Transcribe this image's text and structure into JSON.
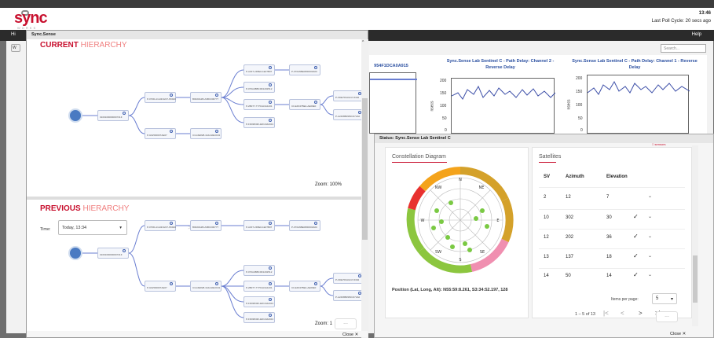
{
  "header": {
    "logo_text": "sync",
    "logo_sub": "WORKS",
    "time": "13:46",
    "poll": "Last Poll Cycle: 20 secs ago"
  },
  "nav": {
    "left_fragment": "Hi",
    "help": "Help",
    "search_placeholder": "Search..."
  },
  "background": {
    "button_fragment": "W",
    "partial_id": "954F1DCA0A915",
    "chart2_title": "Sync.Sense Lab Sentinel C - Path Delay: Channel 2 - Reverse Delay",
    "chart3_title": "Sync.Sense Lab Sentinel C - Path Delay: Channel 1 - Reverse Delay",
    "y_unit": "nsecs",
    "chart2_ticks": [
      "200",
      "150",
      "100",
      "50",
      "0"
    ],
    "chart3_ticks": [
      "200",
      "150",
      "100",
      "50",
      "0"
    ]
  },
  "left_window": {
    "title": "Sync.Sense",
    "current_title_a": "CURRENT",
    "current_title_b": " HIERARCHY",
    "previous_title_a": "PREVIOUS",
    "previous_title_b": " HIERARCHY",
    "zoom_current": "Zoom: 100%",
    "zoom_previous": "Zoom: 1",
    "time_label": "Time:",
    "time_value": "Today, 13:34",
    "pager": [
      "|<",
      "<",
      ">",
      ">|"
    ],
    "close": "Close ✕",
    "more": "...",
    "root_label": "0100100000000741F",
    "root_label_prev": "0100100000000741F",
    "cards": {
      "c1": "P-070D-A1A4F4227-N5920",
      "c2": "0100100000000741F",
      "c3": "P-0A2500007AE07",
      "c4": "B0020A2B-A3BC000777",
      "c5": "P-A3F7-2F8E0-1E07B07",
      "c6": "P-070A6BE0800000A0C",
      "c7": "P-070A4BBC0D1202512",
      "c8": "C0-EF047BE4-AE00E0",
      "c9": "P-2B077-777F4A3A1201",
      "c10": "P-FD03843F-EDCA6A913",
      "c11": "P-FDE7FFA02-P-6302",
      "c12": "P-A2468B0950C074A0",
      "c13": "C14-6E828-4A9-A0E3C01"
    }
  },
  "right_window": {
    "title": "Status: Sync.Sense Lab Sentinel C",
    "red_fragment": "□ sensors",
    "constellation_tab": "Constellation Diagram",
    "position": "Position (Lat, Long, Alt): N55:59:8.261, S3:34:52.197, 128",
    "satellites_tab": "Satellites",
    "cols": [
      "SV",
      "Azimuth",
      "Elevation"
    ],
    "rows": [
      {
        "sv": "2",
        "az": "12",
        "el": "7",
        "check": ""
      },
      {
        "sv": "10",
        "az": "302",
        "el": "30",
        "check": "✓"
      },
      {
        "sv": "12",
        "az": "202",
        "el": "36",
        "check": "✓"
      },
      {
        "sv": "13",
        "az": "137",
        "el": "18",
        "check": "✓"
      },
      {
        "sv": "14",
        "az": "50",
        "el": "14",
        "check": "✓"
      }
    ],
    "items_per_page_label": "Items per page:",
    "items_per_page": "5",
    "range": "1 – 5 of 13",
    "pager": [
      "|<",
      "<",
      ">",
      ">|"
    ],
    "close": "Close ✕",
    "more": "...",
    "compass": [
      "N",
      "NE",
      "E",
      "SE",
      "S",
      "SW",
      "W",
      "NW"
    ]
  }
}
